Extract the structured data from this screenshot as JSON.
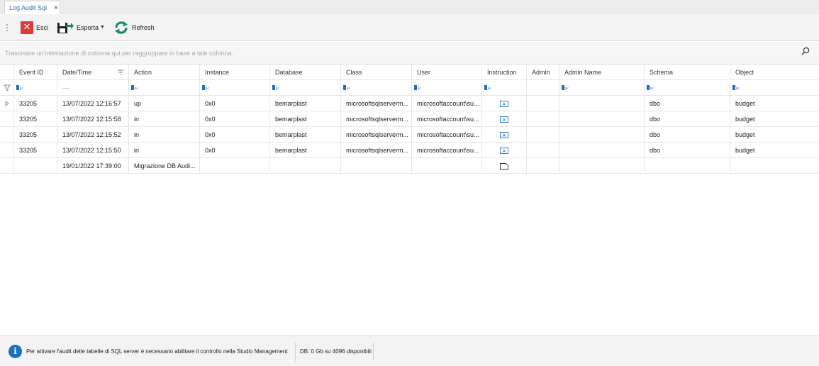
{
  "tab": {
    "label": "Log Audit Sql",
    "close": "×"
  },
  "toolbar": {
    "exit_label": "Esci",
    "export_label": "Esporta",
    "refresh_label": "Refresh"
  },
  "group_panel": {
    "hint": "Trascinare un'intestazione di colonna qui per raggruppare in base a tale colonna."
  },
  "grid": {
    "columns": [
      "Event ID",
      "Date/Time",
      "Action",
      "Instance",
      "Database",
      "Class",
      "User",
      "Instruction",
      "Admin",
      "Admin Name",
      "Schema",
      "Object"
    ],
    "filter_datetime": "—",
    "rows": [
      {
        "event_id": "33205",
        "datetime": "13/07/2022 12:16:57",
        "action": "up",
        "instance": "0x0",
        "database": "bemarplast",
        "class": "microsoftsqlserverm...",
        "user": "microsoftaccount\\su...",
        "admin": "",
        "admin_name": "",
        "schema": "dbo",
        "object": "budget"
      },
      {
        "event_id": "33205",
        "datetime": "13/07/2022 12:15:58",
        "action": "in",
        "instance": "0x0",
        "database": "bemarplast",
        "class": "microsoftsqlserverm...",
        "user": "microsoftaccount\\su...",
        "admin": "",
        "admin_name": "",
        "schema": "dbo",
        "object": "budget"
      },
      {
        "event_id": "33205",
        "datetime": "13/07/2022 12:15:52",
        "action": "in",
        "instance": "0x0",
        "database": "bemarplast",
        "class": "microsoftsqlserverm...",
        "user": "microsoftaccount\\su...",
        "admin": "",
        "admin_name": "",
        "schema": "dbo",
        "object": "budget"
      },
      {
        "event_id": "33205",
        "datetime": "13/07/2022 12:15:50",
        "action": "in",
        "instance": "0x0",
        "database": "bemarplast",
        "class": "microsoftsqlserverm...",
        "user": "microsoftaccount\\su...",
        "admin": "",
        "admin_name": "",
        "schema": "dbo",
        "object": "budget"
      },
      {
        "event_id": "",
        "datetime": "19/01/2022 17:39:00",
        "action": "Migrazione DB Audi...",
        "instance": "",
        "database": "",
        "class": "",
        "user": "",
        "admin": "",
        "admin_name": "",
        "schema": "",
        "object": ""
      }
    ]
  },
  "status": {
    "message": "Per attivare l'audit delle tabelle di SQL server è necessario abilitare il controllo nella Studio Management",
    "db": "DB: 0 Gb su 4096 disponibili"
  },
  "colors": {
    "accent": "#2a6ebb",
    "exit": "#e03a3a",
    "refresh": "#1a8a6a",
    "info": "#1a6fc1"
  }
}
